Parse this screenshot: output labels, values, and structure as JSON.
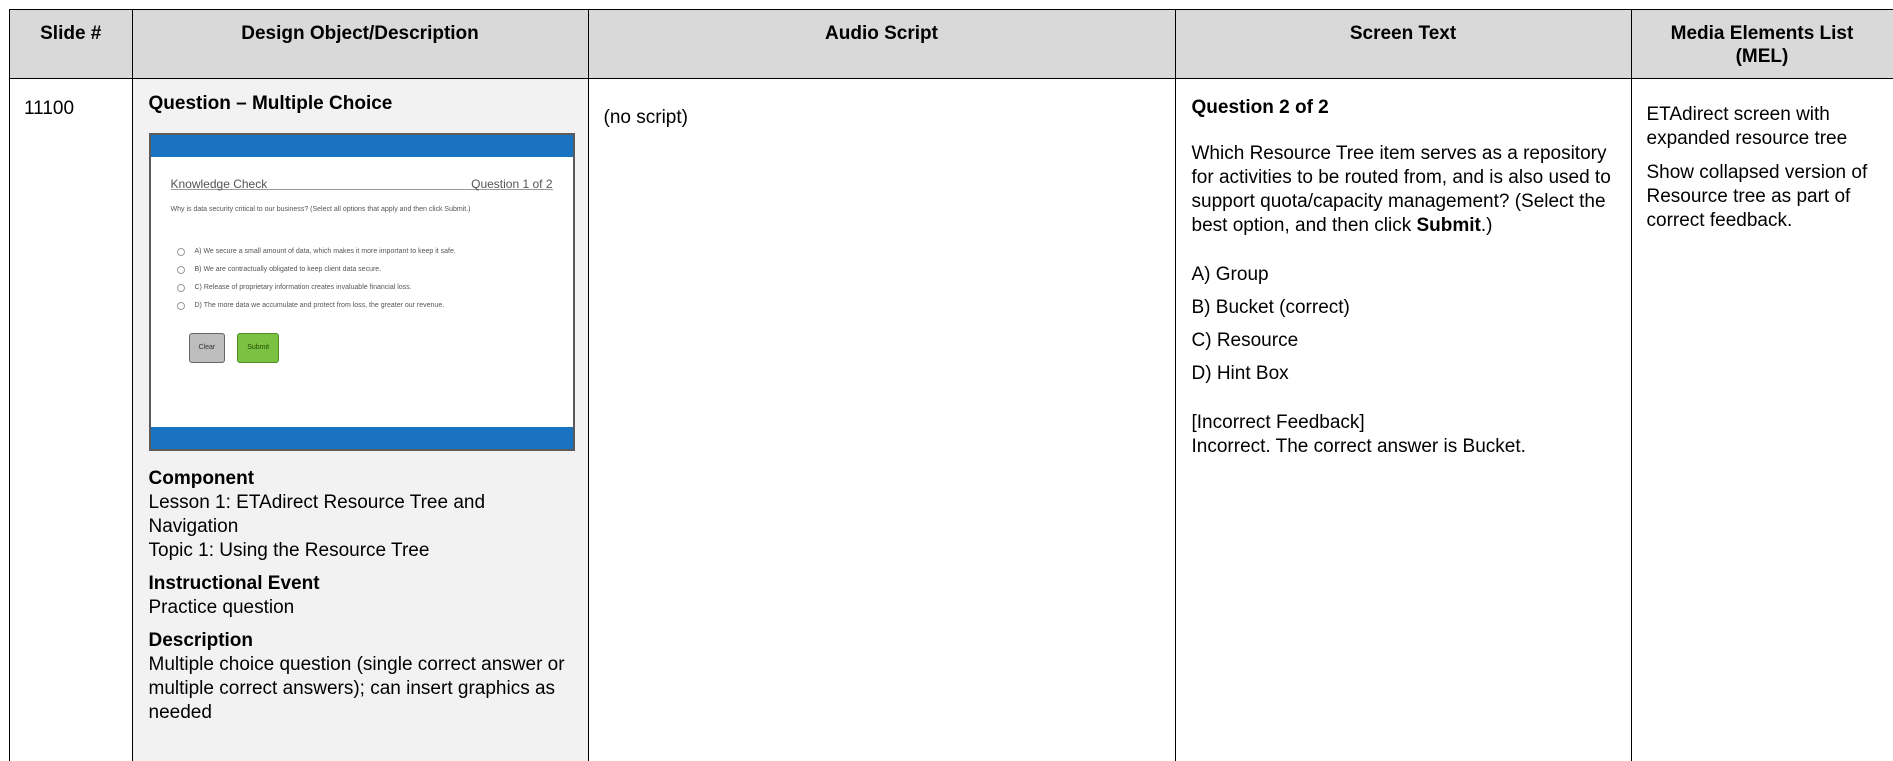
{
  "headers": {
    "slide": "Slide #",
    "design": "Design Object/Description",
    "audio": "Audio Script",
    "screen": "Screen Text",
    "mel_line1": "Media Elements List",
    "mel_line2": "(MEL)"
  },
  "row": {
    "slide_number": "11100",
    "design": {
      "title": "Question – Multiple Choice",
      "thumbnail": {
        "heading": "Knowledge Check",
        "counter": "Question 1 of 2",
        "question": "Why is data security critical to our business? (Select all options that apply and then click Submit.)",
        "options": [
          "A) We secure a small amount of data, which makes it more important to keep it safe.",
          "B) We are contractually obligated to keep client data secure.",
          "C) Release of proprietary information creates invaluable financial loss.",
          "D) The more data we accumulate and protect from loss, the greater our revenue."
        ],
        "clear_label": "Clear",
        "submit_label": "Submit"
      },
      "component_label": "Component",
      "component_line1": "Lesson 1: ETAdirect Resource Tree and Navigation",
      "component_line2": "Topic 1: Using the Resource Tree",
      "event_label": "Instructional Event",
      "event_value": "Practice question",
      "description_label": "Description",
      "description_value": "Multiple choice question (single correct answer or multiple correct answers); can insert graphics as needed"
    },
    "audio": "(no script)",
    "screen": {
      "question_title": "Question 2 of 2",
      "question_text_before": "Which Resource Tree item serves as a repository for activities to be routed from, and is also used to support quota/capacity management? (Select the best option, and then click ",
      "question_text_bold": "Submit",
      "question_text_after": ".)",
      "answers": [
        "A) Group",
        "B) Bucket (correct)",
        "C) Resource",
        "D) Hint Box"
      ],
      "feedback_label": "[Incorrect Feedback]",
      "feedback_text": "Incorrect. The correct answer is Bucket."
    },
    "mel": [
      "ETAdirect screen with expanded resource tree",
      "Show collapsed version of Resource tree as part of correct feedback."
    ]
  }
}
